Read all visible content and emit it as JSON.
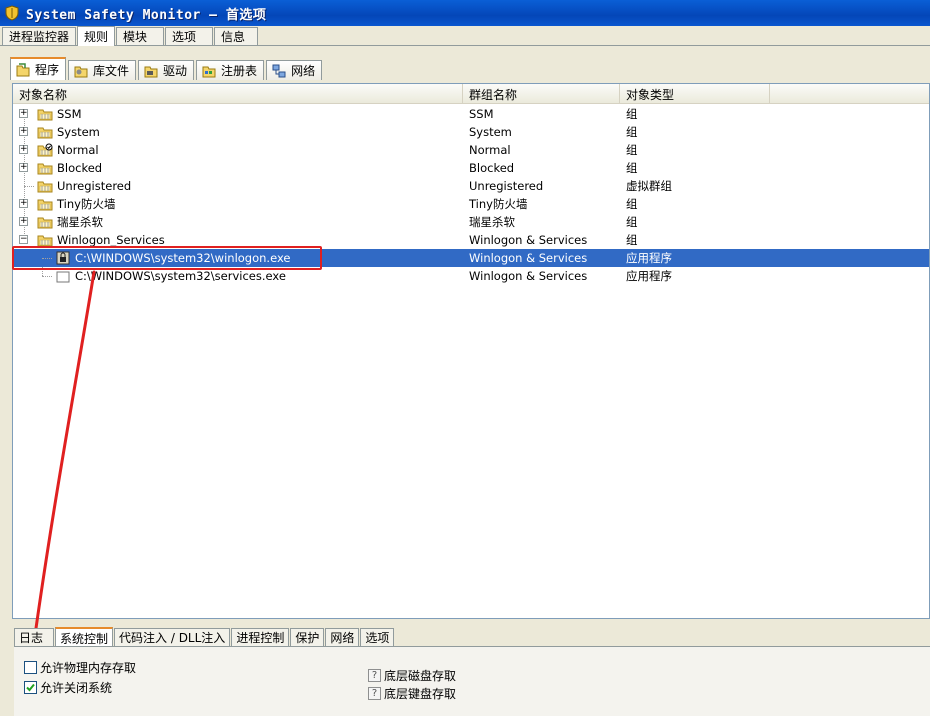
{
  "window": {
    "title": "System Safety Monitor — 首选项"
  },
  "main_tabs": [
    {
      "label": "进程监控器"
    },
    {
      "label": "规则"
    },
    {
      "label": "模块"
    },
    {
      "label": "选项"
    },
    {
      "label": "信息"
    }
  ],
  "sub_tabs": [
    {
      "label": "程序"
    },
    {
      "label": "库文件"
    },
    {
      "label": "驱动"
    },
    {
      "label": "注册表"
    },
    {
      "label": "网络"
    }
  ],
  "columns": [
    "对象名称",
    "群组名称",
    "对象类型"
  ],
  "rows": [
    {
      "name": "SSM",
      "group": "SSM",
      "type": "组"
    },
    {
      "name": "System",
      "group": "System",
      "type": "组"
    },
    {
      "name": "Normal",
      "group": "Normal",
      "type": "组"
    },
    {
      "name": "Blocked",
      "group": "Blocked",
      "type": "组"
    },
    {
      "name": "Unregistered",
      "group": "Unregistered",
      "type": "虚拟群组"
    },
    {
      "name": "Tiny防火墙",
      "group": "Tiny防火墙",
      "type": "组"
    },
    {
      "name": "瑞星杀软",
      "group": "瑞星杀软",
      "type": "组"
    },
    {
      "name": "Winlogon_Services",
      "group": "Winlogon & Services",
      "type": "组"
    },
    {
      "name": "C:\\WINDOWS\\system32\\winlogon.exe",
      "group": "Winlogon & Services",
      "type": "应用程序"
    },
    {
      "name": "C:\\WINDOWS\\system32\\services.exe",
      "group": "Winlogon & Services",
      "type": "应用程序"
    }
  ],
  "bottom_tabs": [
    {
      "label": "日志"
    },
    {
      "label": "系统控制"
    },
    {
      "label": "代码注入 / DLL注入"
    },
    {
      "label": "进程控制"
    },
    {
      "label": "保护"
    },
    {
      "label": "网络"
    },
    {
      "label": "选项"
    }
  ],
  "options": {
    "phys_mem": "允许物理内存存取",
    "shutdown": "允许关闭系统",
    "disk": "底层磁盘存取",
    "keyboard": "底层键盘存取"
  },
  "colors": {
    "selection": "#316AC5",
    "annotation": "#E02020",
    "titlebar": "#0A5FD6"
  }
}
